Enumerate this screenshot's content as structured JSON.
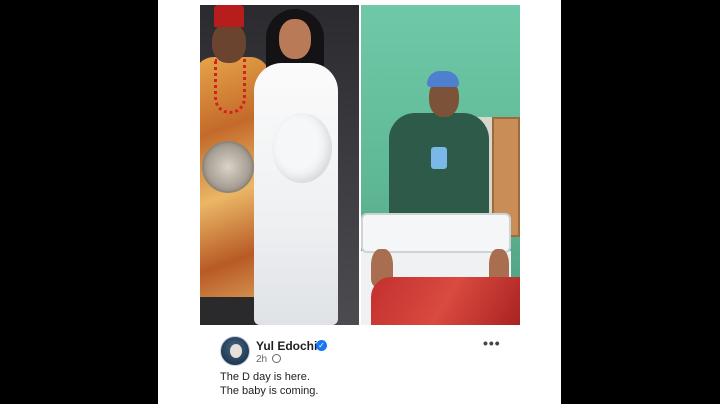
{
  "post": {
    "author_name": "Yul Edochie",
    "verified_mark": "✓",
    "timestamp": "2h",
    "audience_icon": "globe-icon",
    "more_options_label": "•••",
    "text_lines": [
      "The D day is here.",
      "The baby is coming."
    ]
  },
  "colors": {
    "background": "#000000",
    "card": "#ffffff",
    "verified_badge": "#1877f2",
    "name_text": "#1c1e21",
    "meta_text": "#65676b"
  }
}
